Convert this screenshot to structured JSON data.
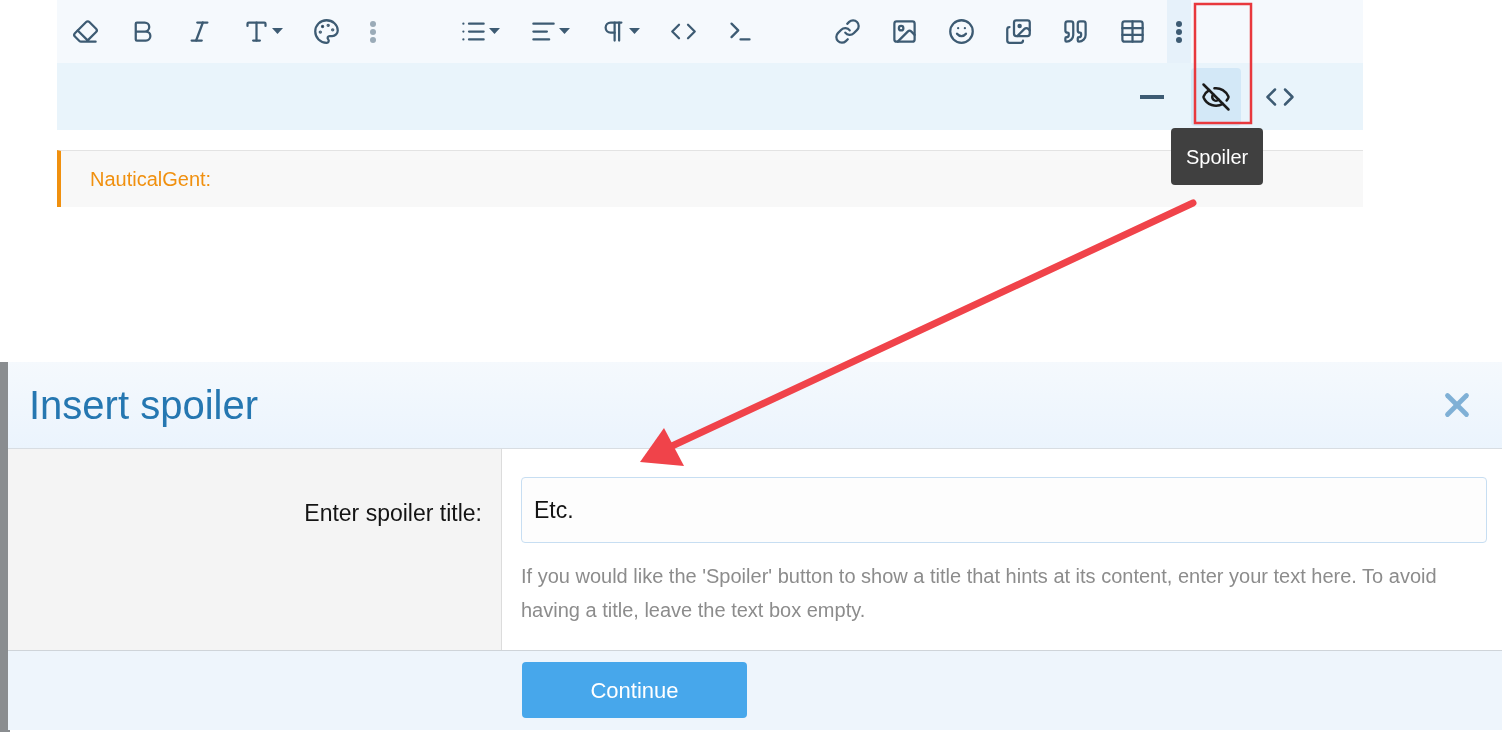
{
  "toolbar": {
    "groups": [
      {
        "buttons": [
          {
            "dropdown": false,
            "selected": false
          },
          {
            "dropdown": false,
            "selected": false
          },
          {
            "dropdown": false,
            "selected": false
          },
          {
            "dropdown": true,
            "selected": false
          },
          {
            "dropdown": false,
            "selected": false
          },
          {
            "dropdown": false,
            "selected": false
          }
        ]
      },
      {
        "buttons": [
          {
            "dropdown": true,
            "selected": false
          },
          {
            "dropdown": true,
            "selected": false
          },
          {
            "dropdown": true,
            "selected": false
          },
          {
            "dropdown": false,
            "selected": false
          },
          {
            "dropdown": false,
            "selected": false
          }
        ]
      },
      {
        "buttons": [
          {
            "dropdown": false,
            "selected": false
          },
          {
            "dropdown": false,
            "selected": false
          },
          {
            "dropdown": false,
            "selected": false
          },
          {
            "dropdown": false,
            "selected": false
          },
          {
            "dropdown": false,
            "selected": false
          },
          {
            "dropdown": false,
            "selected": false
          },
          {
            "dropdown": false,
            "selected": true
          }
        ]
      }
    ]
  },
  "more_toolbar": {
    "buttons": [
      {
        "selected": false
      },
      {
        "selected": true
      },
      {
        "selected": false
      }
    ]
  },
  "tooltip": "Spoiler",
  "quote": {
    "author": "NauticalGent:"
  },
  "dialog": {
    "title": "Insert spoiler",
    "field": {
      "label": "Enter spoiler title:",
      "value": "Etc.",
      "hint": "If you would like the 'Spoiler' button to show a title that hints at its content, enter your text here. To avoid having a title, leave the text box empty."
    },
    "button": "Continue"
  }
}
